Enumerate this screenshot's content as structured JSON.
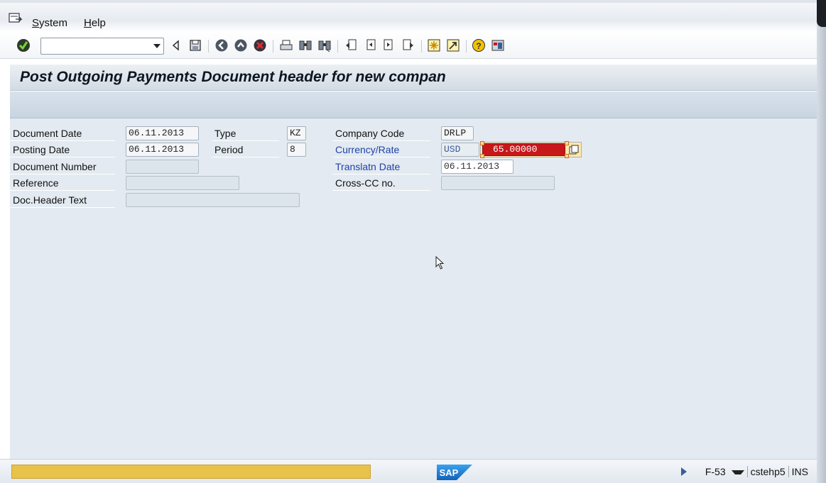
{
  "menubar": {
    "items": [
      {
        "label_pre": "",
        "label_ul": "S",
        "label_post": "ystem"
      },
      {
        "label_pre": "",
        "label_ul": "H",
        "label_post": "elp"
      }
    ]
  },
  "toolbar": {
    "command_field_value": "",
    "icons": [
      "enter-check-icon",
      "back-arrow-icon",
      "save-icon",
      "back-icon",
      "exit-icon",
      "cancel-icon",
      "print-icon",
      "find-icon",
      "find-next-icon",
      "first-page-icon",
      "previous-page-icon",
      "next-page-icon",
      "last-page-icon",
      "create-session-icon",
      "create-shortcut-icon",
      "help-icon",
      "customize-layout-icon"
    ]
  },
  "page": {
    "title": "Post Outgoing Payments Document header for new compan"
  },
  "form": {
    "document_date_label": "Document Date",
    "document_date_value": "06.11.2013",
    "type_label": "Type",
    "type_value": "KZ",
    "company_code_label": "Company Code",
    "company_code_value": "DRLP",
    "posting_date_label": "Posting Date",
    "posting_date_value": "06.11.2013",
    "period_label": "Period",
    "period_value": "8",
    "currency_rate_label": "Currency/Rate",
    "currency_value": "USD",
    "rate_value": "65.00000",
    "document_number_label": "Document Number",
    "document_number_value": "",
    "translation_date_label": "Translatn Date",
    "translation_date_value": "06.11.2013",
    "reference_label": "Reference",
    "reference_value": "",
    "cross_cc_label": "Cross-CC no.",
    "cross_cc_value": "",
    "doc_header_text_label": "Doc.Header Text",
    "doc_header_text_value": ""
  },
  "statusbar": {
    "message": "",
    "logo_text": "SAP",
    "transaction": "F-53",
    "server": "cstehp5",
    "mode": "INS"
  },
  "colors": {
    "error_field": "#c8171a",
    "status_highlight": "#e8c24a",
    "label_blue": "#2043a8",
    "sap_blue": "#1b73c7"
  }
}
